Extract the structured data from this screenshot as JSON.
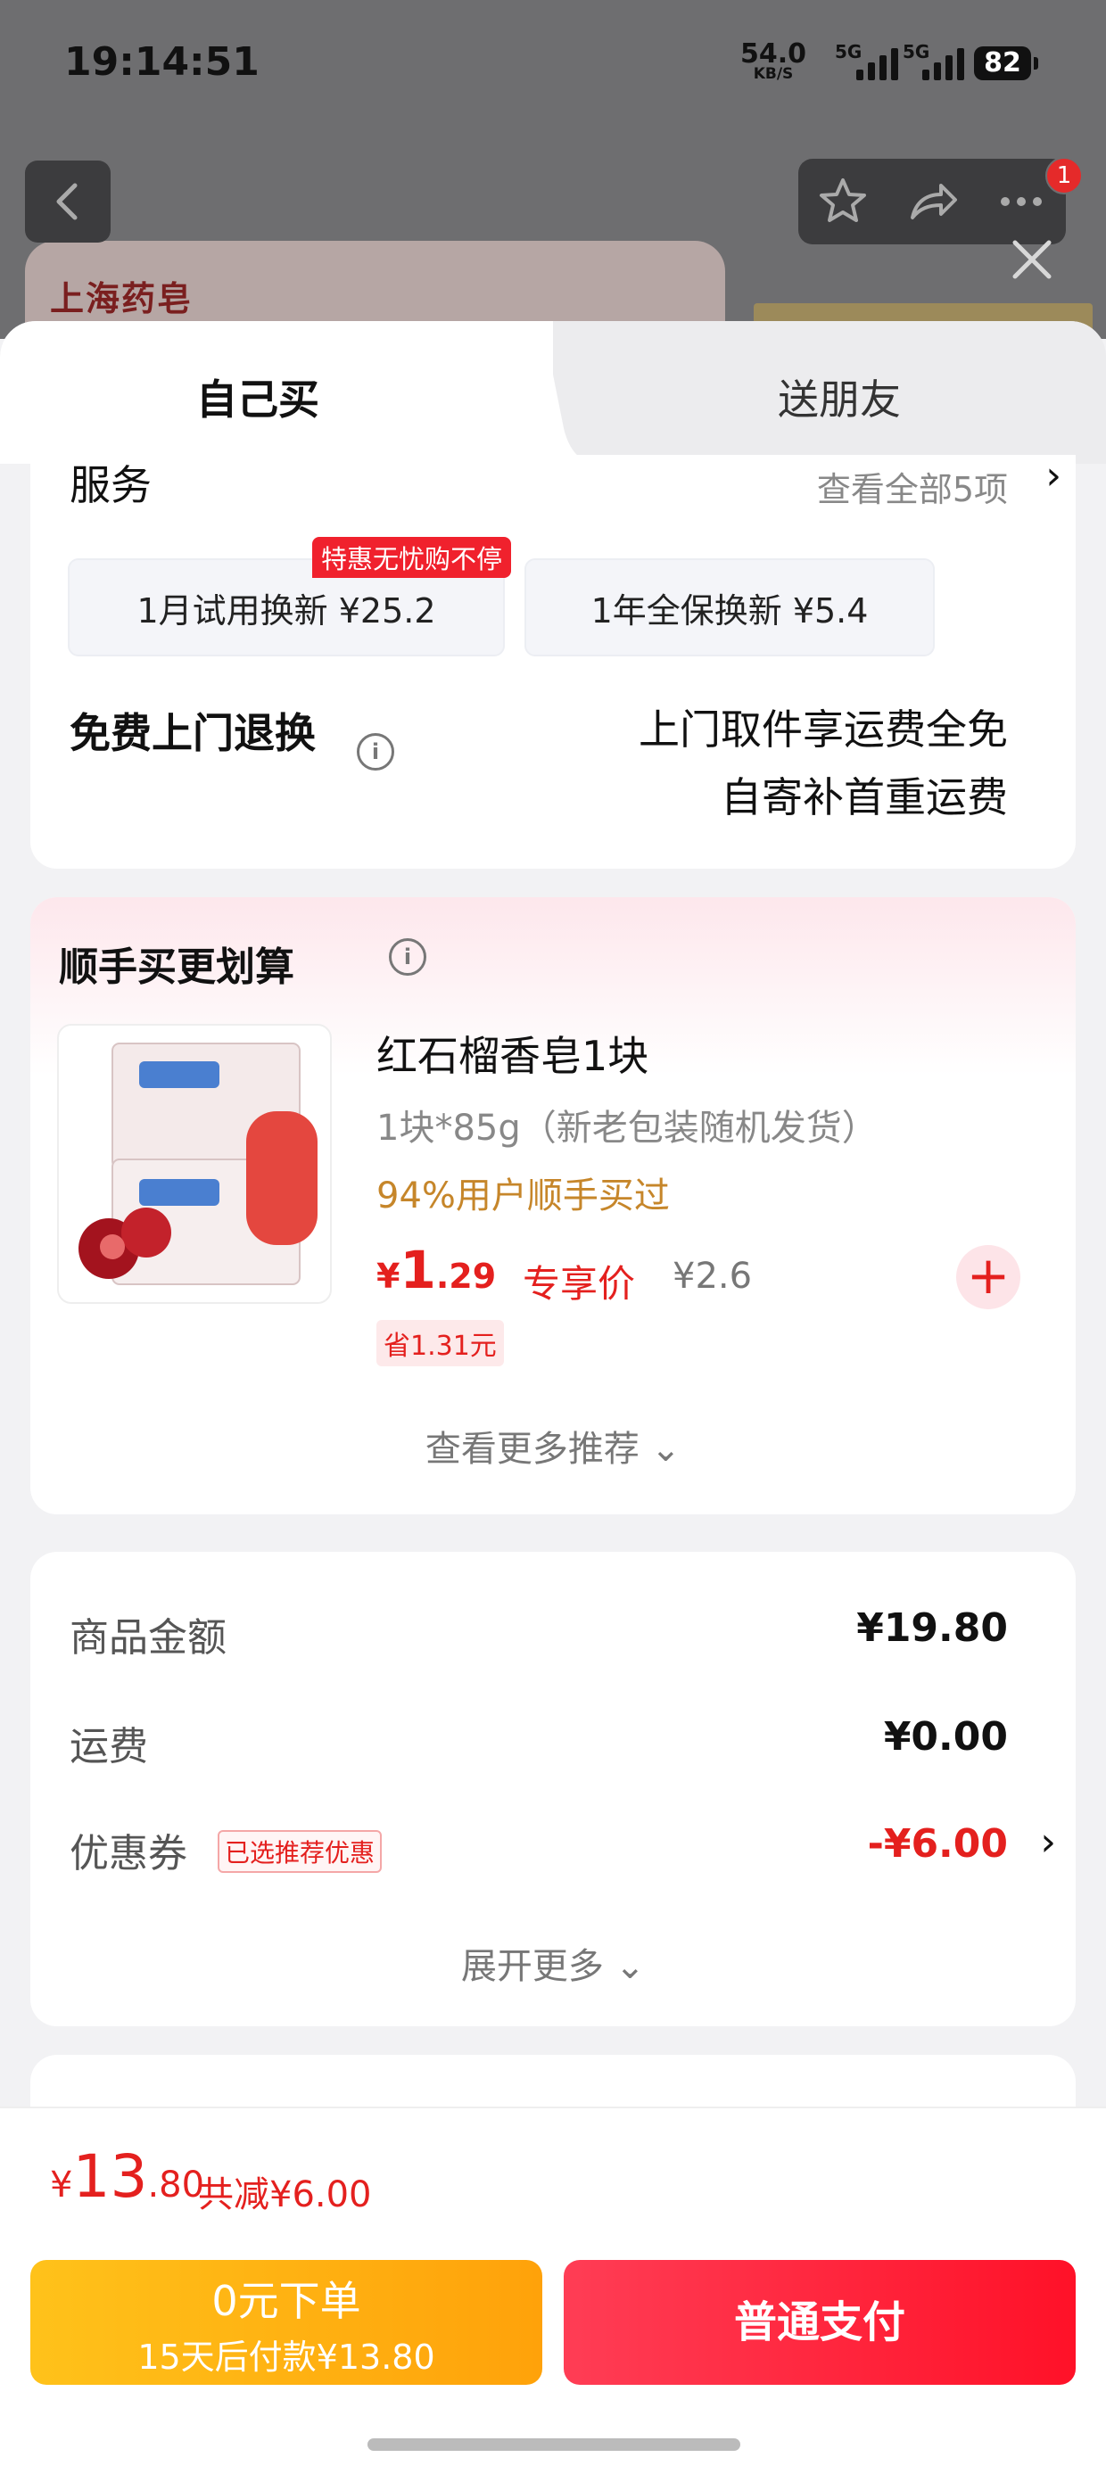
{
  "status_bar": {
    "time": "19:14:51",
    "net_speed": "54.0",
    "net_unit": "KB/S",
    "sim1": "5G",
    "sim2": "5G",
    "battery": "82"
  },
  "background_page": {
    "brand": "上海药皂",
    "cart_badge": "1"
  },
  "tabs": {
    "own": "自己买",
    "friend": "送朋友"
  },
  "service": {
    "title": "服务",
    "view_all": "查看全部5项",
    "chevron": "›",
    "options": [
      {
        "label": "1月试用换新  ¥25.2",
        "tag": "特惠无忧购不停"
      },
      {
        "label": "1年全保换新  ¥5.4"
      }
    ],
    "return_title": "免费上门退换",
    "info": "i",
    "return_lines": [
      "上门取件享运费全免",
      "自寄补首重运费"
    ]
  },
  "recommend": {
    "title": "顺手买更划算",
    "info": "i",
    "product": {
      "name": "红石榴香皂1块",
      "spec": "1块*85g（新老包装随机发货）",
      "social": "94%用户顺手买过",
      "price_currency": "¥",
      "price_int": "1",
      "price_dec": ".29",
      "exclusive": "专享价",
      "original_price": "¥2.6",
      "save": "省1.31元",
      "add": "+"
    },
    "more": "查看更多推荐 ⌄"
  },
  "summary": {
    "goods_label": "商品金额",
    "goods_value": "¥19.80",
    "shipping_label": "运费",
    "shipping_value": "¥0.00",
    "coupon_label": "优惠券",
    "coupon_tag": "已选推荐优惠",
    "coupon_value": "-¥6.00",
    "chevron": "›",
    "expand": "展开更多 ⌄"
  },
  "footer": {
    "total_currency": "¥",
    "total_int": "13",
    "total_dec": ".80",
    "reduce": "共减¥6.00",
    "zero_line1": "0元下单",
    "zero_line2": "15天后付款¥13.80",
    "pay": "普通支付"
  },
  "colors": {
    "accent_red": "#e4201e",
    "pay_button": "#ff1128",
    "zero_button": "#ffa20a",
    "social_text": "#c6862a"
  }
}
